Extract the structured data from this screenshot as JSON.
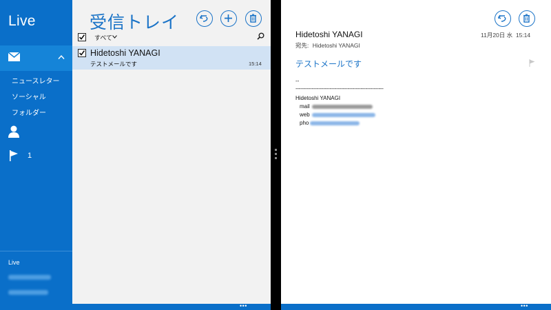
{
  "nav": {
    "app_title": "Live",
    "folders": [
      "ニュースレター",
      "ソーシャル",
      "フォルダー"
    ],
    "flag_count": "1",
    "account_label": "Live",
    "colors": {
      "background": "#0a6fc9",
      "selected": "#1584d8"
    }
  },
  "list": {
    "title": "受信トレイ",
    "filter_label": "すべて",
    "message": {
      "sender": "Hidetoshi YANAGI",
      "subject": "テストメールです",
      "time": "15:14",
      "checked": true
    },
    "colors": {
      "accent": "#1a73c7",
      "selected_row": "#d1e2f4"
    }
  },
  "reader": {
    "from": "Hidetoshi YANAGI",
    "to_label": "宛先:",
    "to_name": "Hidetoshi YANAGI",
    "date": "11月20日 水  15:14",
    "subject": "テストメールです",
    "body": {
      "sig_separator_short": "--",
      "sig_separator_long": "------------------------------------------------------",
      "sig_name": "Hidetoshi YANAGI",
      "mail_label": "mail",
      "web_label": "web",
      "phone_label": "pho"
    }
  },
  "icons": {
    "reply": "reply-icon",
    "new": "add-icon",
    "delete": "trash-icon",
    "search": "search-icon",
    "mail": "mail-icon",
    "people": "person-icon",
    "flag": "flag-icon"
  },
  "bottom_bar": {
    "more_label": "•••"
  }
}
